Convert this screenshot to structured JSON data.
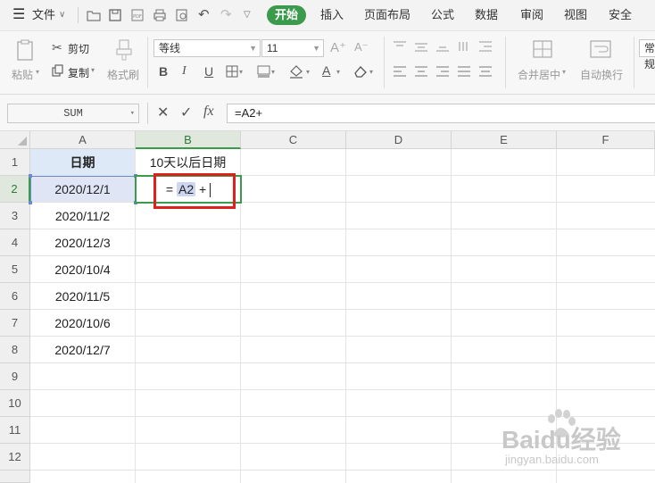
{
  "menu": {
    "file": "文件",
    "tabs": [
      "开始",
      "插入",
      "页面布局",
      "公式",
      "数据",
      "审阅",
      "视图",
      "安全"
    ]
  },
  "ribbon": {
    "paste": "粘贴",
    "cut": "剪切",
    "copy": "复制",
    "format_painter": "格式刷",
    "font_name": "等线",
    "font_size": "11",
    "merge_center": "合并居中",
    "wrap_text": "自动换行",
    "number_format": "常规"
  },
  "formula_bar": {
    "name_box": "SUM",
    "fx": "fx",
    "formula": "=A2+"
  },
  "sheet": {
    "columns": [
      "A",
      "B",
      "C",
      "D",
      "E",
      "F"
    ],
    "rows": [
      "1",
      "2",
      "3",
      "4",
      "5",
      "6",
      "7",
      "8",
      "9",
      "10",
      "11",
      "12"
    ],
    "cells": {
      "A1": "日期",
      "B1": "10天以后日期",
      "A2": "2020/12/1",
      "A3": "2020/11/2",
      "A4": "2020/12/3",
      "A5": "2020/10/4",
      "A6": "2020/11/5",
      "A7": "2020/10/6",
      "A8": "2020/12/7"
    },
    "editing": {
      "eq": "=",
      "ref": "A2",
      "op": "+"
    }
  },
  "watermark": {
    "logo": "Baidu经验",
    "url": "jingyan.baidu.com"
  },
  "colors": {
    "accent": "#3b9a4b",
    "highlight": "#e0201c",
    "reference": "#6a8ad0"
  }
}
